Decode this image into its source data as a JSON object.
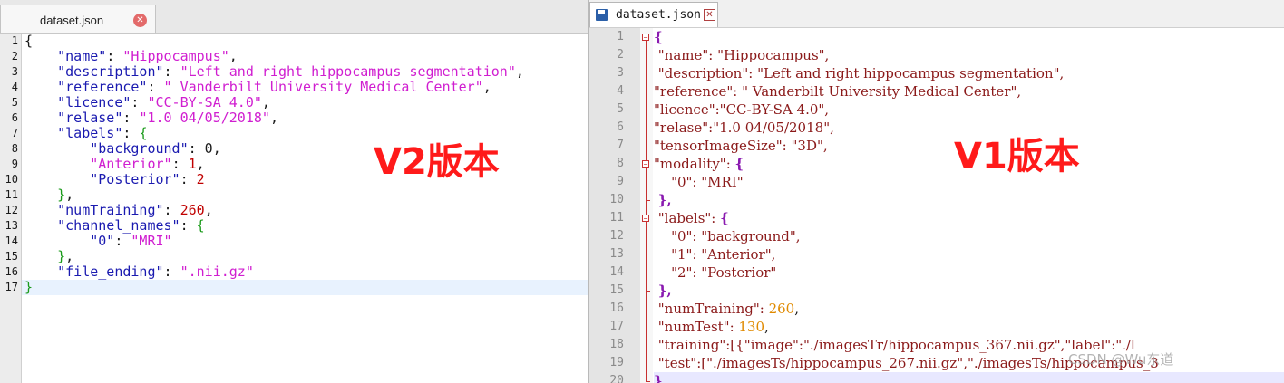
{
  "left_editor": {
    "tab": {
      "title": "dataset.json",
      "close_icon": "close-icon"
    },
    "line_numbers": [
      "1",
      "2",
      "3",
      "4",
      "5",
      "6",
      "7",
      "8",
      "9",
      "10",
      "11",
      "12",
      "13",
      "14",
      "15",
      "16",
      "17"
    ],
    "lines": [
      [
        [
          "p",
          "{"
        ]
      ],
      [
        [
          "p",
          "    "
        ],
        [
          "k",
          "\"name\""
        ],
        [
          "p",
          ": "
        ],
        [
          "s",
          "\"Hippocampus\""
        ],
        [
          "p",
          ","
        ]
      ],
      [
        [
          "p",
          "    "
        ],
        [
          "k",
          "\"description\""
        ],
        [
          "p",
          ": "
        ],
        [
          "s",
          "\"Left and right hippocampus segmentation\""
        ],
        [
          "p",
          ","
        ]
      ],
      [
        [
          "p",
          "    "
        ],
        [
          "k",
          "\"reference\""
        ],
        [
          "p",
          ": "
        ],
        [
          "s",
          "\" Vanderbilt University Medical Center\""
        ],
        [
          "p",
          ","
        ]
      ],
      [
        [
          "p",
          "    "
        ],
        [
          "k",
          "\"licence\""
        ],
        [
          "p",
          ": "
        ],
        [
          "s",
          "\"CC-BY-SA 4.0\""
        ],
        [
          "p",
          ","
        ]
      ],
      [
        [
          "p",
          "    "
        ],
        [
          "k",
          "\"relase\""
        ],
        [
          "p",
          ": "
        ],
        [
          "s",
          "\"1.0 04/05/2018\""
        ],
        [
          "p",
          ","
        ]
      ],
      [
        [
          "p",
          "    "
        ],
        [
          "k",
          "\"labels\""
        ],
        [
          "p",
          ": "
        ],
        [
          "b",
          "{"
        ]
      ],
      [
        [
          "p",
          "        "
        ],
        [
          "k",
          "\"background\""
        ],
        [
          "p",
          ": 0,"
        ]
      ],
      [
        [
          "p",
          "        "
        ],
        [
          "s",
          "\"Anterior\""
        ],
        [
          "p",
          ": "
        ],
        [
          "n",
          "1"
        ],
        [
          "p",
          ","
        ]
      ],
      [
        [
          "p",
          "        "
        ],
        [
          "k",
          "\"Posterior\""
        ],
        [
          "p",
          ": "
        ],
        [
          "n",
          "2"
        ]
      ],
      [
        [
          "p",
          "    "
        ],
        [
          "b",
          "}"
        ],
        [
          "p",
          ","
        ]
      ],
      [
        [
          "p",
          "    "
        ],
        [
          "k",
          "\"numTraining\""
        ],
        [
          "p",
          ": "
        ],
        [
          "n",
          "260"
        ],
        [
          "p",
          ","
        ]
      ],
      [
        [
          "p",
          "    "
        ],
        [
          "k",
          "\"channel_names\""
        ],
        [
          "p",
          ": "
        ],
        [
          "b",
          "{"
        ]
      ],
      [
        [
          "p",
          "        "
        ],
        [
          "k",
          "\"0\""
        ],
        [
          "p",
          ": "
        ],
        [
          "s",
          "\"MRI\""
        ]
      ],
      [
        [
          "p",
          "    "
        ],
        [
          "b",
          "}"
        ],
        [
          "p",
          ","
        ]
      ],
      [
        [
          "p",
          "    "
        ],
        [
          "k",
          "\"file_ending\""
        ],
        [
          "p",
          ": "
        ],
        [
          "s",
          "\".nii.gz\""
        ]
      ],
      [
        [
          "b",
          "}"
        ]
      ]
    ],
    "highlighted_line": 17
  },
  "right_editor": {
    "tab": {
      "title": "dataset.json",
      "save_icon": "floppy-disk-icon",
      "close_icon": "close-icon"
    },
    "line_numbers": [
      "1",
      "2",
      "3",
      "4",
      "5",
      "6",
      "7",
      "8",
      "9",
      "10",
      "11",
      "12",
      "13",
      "14",
      "15",
      "16",
      "17",
      "18",
      "19",
      "20"
    ],
    "lines": [
      [
        [
          "b",
          "{"
        ]
      ],
      [
        [
          "p",
          " "
        ],
        [
          "k",
          "\"name\": \"Hippocampus\","
        ]
      ],
      [
        [
          "p",
          " "
        ],
        [
          "k",
          "\"description\": \"Left and right hippocampus segmentation\","
        ]
      ],
      [
        [
          "k",
          "\"reference\": \" Vanderbilt University Medical Center\","
        ]
      ],
      [
        [
          "k",
          "\"licence\":\"CC-BY-SA 4.0\","
        ]
      ],
      [
        [
          "k",
          "\"relase\":\"1.0 04/05/2018\","
        ]
      ],
      [
        [
          "k",
          "\"tensorImageSize\": \"3D\","
        ]
      ],
      [
        [
          "k",
          "\"modality\": "
        ],
        [
          "b",
          "{"
        ]
      ],
      [
        [
          "p",
          "    "
        ],
        [
          "k",
          "\"0\": \"MRI\""
        ]
      ],
      [
        [
          "p",
          " "
        ],
        [
          "b",
          "},"
        ]
      ],
      [
        [
          "p",
          " "
        ],
        [
          "k",
          "\"labels\": "
        ],
        [
          "b",
          "{"
        ]
      ],
      [
        [
          "p",
          "    "
        ],
        [
          "k",
          "\"0\": \"background\","
        ]
      ],
      [
        [
          "p",
          "    "
        ],
        [
          "k",
          "\"1\": \"Anterior\","
        ]
      ],
      [
        [
          "p",
          "    "
        ],
        [
          "k",
          "\"2\": \"Posterior\""
        ]
      ],
      [
        [
          "p",
          " "
        ],
        [
          "b",
          "},"
        ]
      ],
      [
        [
          "p",
          " "
        ],
        [
          "k",
          "\"numTraining\": "
        ],
        [
          "n",
          "260"
        ],
        [
          "p",
          ","
        ]
      ],
      [
        [
          "p",
          " "
        ],
        [
          "k",
          "\"numTest\": "
        ],
        [
          "n",
          "130"
        ],
        [
          "p",
          ","
        ]
      ],
      [
        [
          "p",
          " "
        ],
        [
          "k",
          "\"training\":[{\"image\":\"./imagesTr/hippocampus_367.nii.gz\",\"label\":\"./l"
        ]
      ],
      [
        [
          "p",
          " "
        ],
        [
          "k",
          "\"test\":[\"./imagesTs/hippocampus_267.nii.gz\",\"./imagesTs/hippocampus_3"
        ]
      ],
      [
        [
          "b",
          "}"
        ]
      ]
    ],
    "highlighted_line": 20
  },
  "annotations": {
    "v2_label": "V2版本",
    "v1_label": "V1版本"
  },
  "watermark": "CSDN @Wu东道"
}
